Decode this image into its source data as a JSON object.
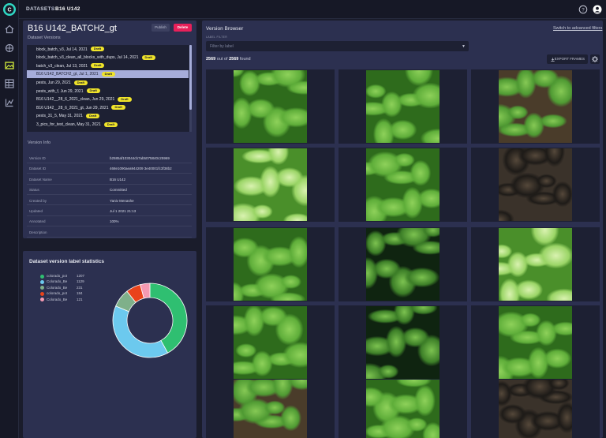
{
  "breadcrumb": {
    "root": "DATASETS",
    "separator": "/",
    "current": "B16 U142"
  },
  "dataset": {
    "title": "B16 U142_BATCH2_gt",
    "publish_label": "Publish",
    "delete_label": "Delete",
    "versions_label": "Dataset Versions",
    "draft_label": "Draft",
    "versions": [
      {
        "name": "block_batch_v3, Jul 14, 2021",
        "draft": true,
        "selected": false
      },
      {
        "name": "block_batch_v3_clean_all_blocks_with_dups, Jul 14, 2021",
        "draft": true,
        "selected": false
      },
      {
        "name": "batch_v3_clean, Jul 13, 2021",
        "draft": true,
        "selected": false
      },
      {
        "name": "B16 U142_BATCH2_gt, Jul 1, 2021",
        "draft": true,
        "selected": true
      },
      {
        "name": "pests, Jun 29, 2021",
        "draft": true,
        "selected": false
      },
      {
        "name": "pests_with_f, Jun 29, 2021",
        "draft": true,
        "selected": false
      },
      {
        "name": "B16 U142__28_6_2021_clean, Jun 29, 2021",
        "draft": true,
        "selected": false
      },
      {
        "name": "B16 U142__28_6_2021_gt, Jun 29, 2021",
        "draft": true,
        "selected": false
      },
      {
        "name": "pests_31_5, May 31, 2021",
        "draft": true,
        "selected": false
      },
      {
        "name": "3_pics_for_test_clean, May 31, 2021",
        "draft": true,
        "selected": false
      }
    ]
  },
  "version_info": {
    "label": "Version Info",
    "rows": [
      {
        "key": "Version ID",
        "value": "b2585af103044cb7ab5075840c25969"
      },
      {
        "key": "Dataset ID",
        "value": "468e1090aea944209 3e40001fc3f38b2"
      },
      {
        "key": "Dataset Name",
        "value": "B16 U142"
      },
      {
        "key": "Status",
        "value": "Committed"
      },
      {
        "key": "Created by",
        "value": "Yaniv Menashe"
      },
      {
        "key": "Updated",
        "value": "Jul 1 2021 21:13"
      },
      {
        "key": "Annotated",
        "value": "100%"
      },
      {
        "key": "Description",
        "value": ""
      }
    ]
  },
  "stats": {
    "title": "Dataset version label statistics",
    "labels": [
      {
        "name": "colorado_pot",
        "count": "1207",
        "value": 1207,
        "color": "#2fbf71"
      },
      {
        "name": "Colorado_Be",
        "count": "1129",
        "value": 1129,
        "color": "#6cc9ee"
      },
      {
        "name": "Colorado_Be",
        "count": "231",
        "value": 231,
        "color": "#7fb08a"
      },
      {
        "name": "colorado_pot",
        "count": "184",
        "value": 184,
        "color": "#e9431b"
      },
      {
        "name": "Colorado_Be",
        "count": "121",
        "value": 121,
        "color": "#f59ab2"
      }
    ]
  },
  "browser": {
    "title": "Version Browser",
    "advanced_link": "Switch to advanced filters",
    "filter_label": "LABEL FILTER",
    "filter_placeholder": "Filter by label",
    "found_count": "2569",
    "found_total": "2569",
    "found_middle": " out of ",
    "found_suffix": " found",
    "export_label": "EXPORT FRAMES",
    "frames": [
      "leaves-dense",
      "leaves-dense",
      "leaves-soil",
      "leaves-bright",
      "leaves-dense",
      "soil-shadow",
      "leaves-dense",
      "leaves-dark",
      "leaves-bright",
      "leaves-dense",
      "leaves-dark",
      "leaves-dense",
      "leaves-soil",
      "leaves-dense",
      "soil-shadow"
    ]
  },
  "icons": {
    "logo": "app-logo-icon",
    "nav": [
      "home-icon",
      "brain-icon",
      "image-icon",
      "table-icon",
      "pipeline-icon"
    ],
    "help": "help-icon",
    "user": "user-avatar-icon",
    "settings": "gear-icon"
  },
  "colors": {
    "accent": "#e8205a",
    "selected": "#a6adda",
    "draft": "#f0e42a",
    "panel": "#2c3050"
  }
}
